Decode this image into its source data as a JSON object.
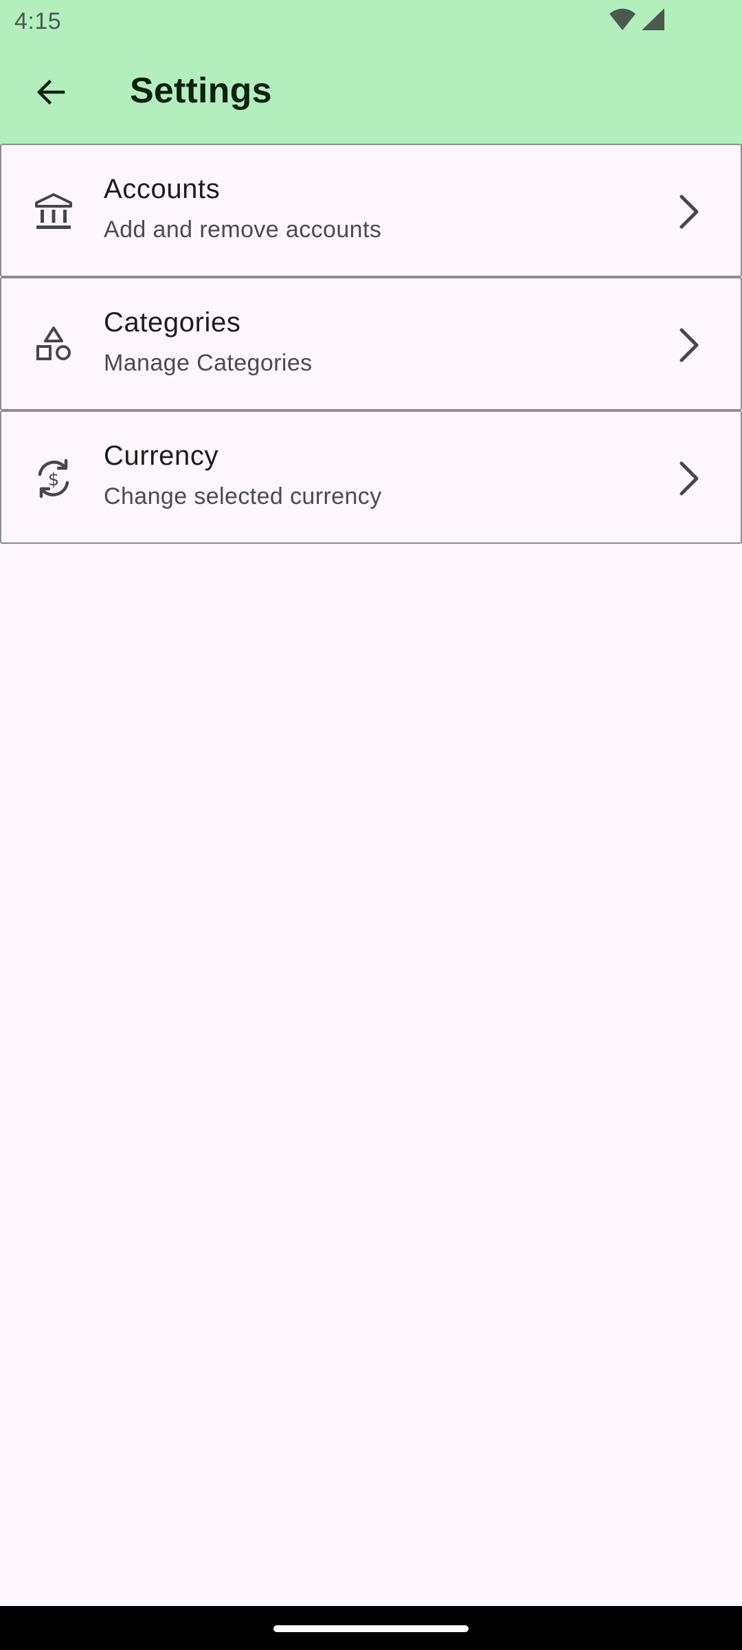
{
  "status_bar": {
    "time": "4:15",
    "icons": [
      "wifi-icon",
      "cellular-signal-icon"
    ]
  },
  "app_bar": {
    "title": "Settings",
    "back_icon": "arrow-back-icon",
    "background_color": "#b3efbd"
  },
  "settings": {
    "items": [
      {
        "title": "Accounts",
        "subtitle": "Add and remove accounts",
        "icon": "bank-icon",
        "trailing_icon": "chevron-right-icon"
      },
      {
        "title": "Categories",
        "subtitle": "Manage Categories",
        "icon": "shapes-icon",
        "trailing_icon": "chevron-right-icon"
      },
      {
        "title": "Currency",
        "subtitle": "Change selected currency",
        "icon": "currency-exchange-icon",
        "trailing_icon": "chevron-right-icon"
      }
    ]
  },
  "colors": {
    "background": "#fdf6fc",
    "title_text": "#0d2110",
    "border": "#8d8d8d"
  }
}
